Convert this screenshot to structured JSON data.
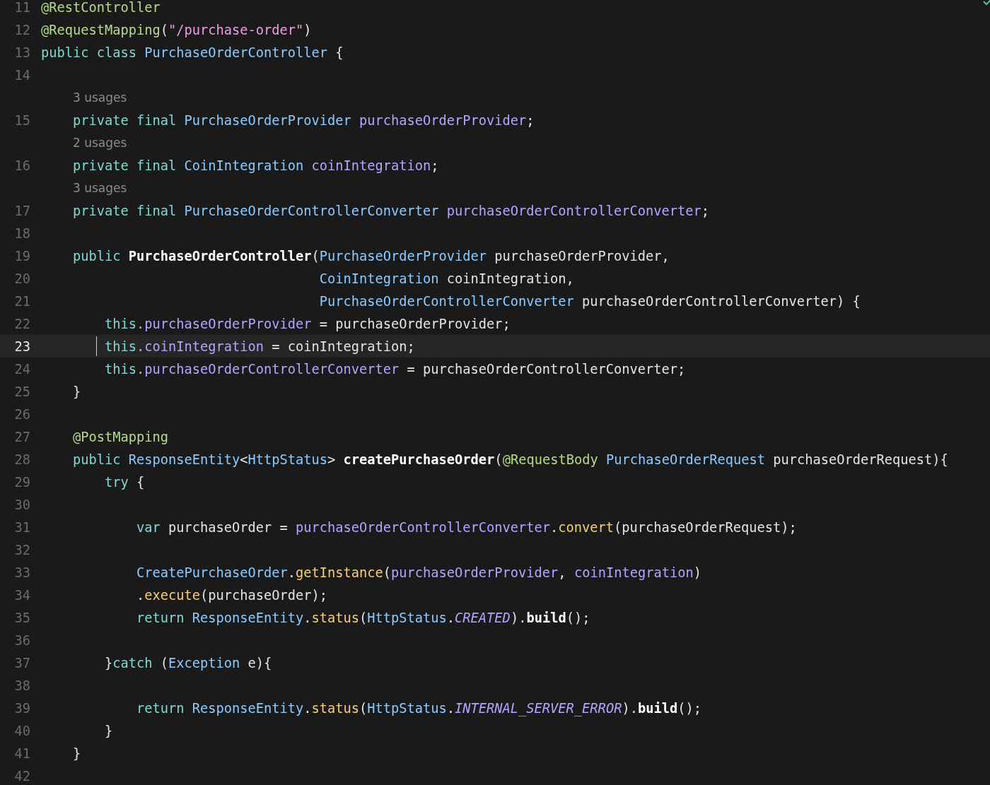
{
  "editor": {
    "lines": [
      {
        "number": "11",
        "kind": "code",
        "current": false,
        "tokens": [
          {
            "text": "@RestController",
            "kind": "annotation"
          }
        ]
      },
      {
        "number": "12",
        "kind": "code",
        "current": false,
        "tokens": [
          {
            "text": "@RequestMapping",
            "kind": "annotation"
          },
          {
            "text": "(",
            "kind": "plain"
          },
          {
            "text": "\"/purchase-order\"",
            "kind": "string"
          },
          {
            "text": ")",
            "kind": "plain"
          }
        ]
      },
      {
        "number": "13",
        "kind": "code",
        "current": false,
        "tokens": [
          {
            "text": "public class ",
            "kind": "keyword"
          },
          {
            "text": "PurchaseOrderController",
            "kind": "type"
          },
          {
            "text": " {",
            "kind": "plain"
          }
        ],
        "children": [
          {
            "number": "14",
            "kind": "code",
            "current": false
          },
          {
            "number": "15",
            "kind": "code",
            "current": false,
            "usages": "3 usages",
            "tokens": [
              {
                "text": "private final ",
                "kind": "keyword"
              },
              {
                "text": "PurchaseOrderProvider ",
                "kind": "type"
              },
              {
                "text": "purchaseOrderProvider",
                "kind": "field"
              },
              {
                "text": ";",
                "kind": "plain"
              }
            ]
          },
          {
            "number": "16",
            "kind": "code",
            "current": false,
            "usages": "2 usages",
            "tokens": [
              {
                "text": "private final ",
                "kind": "keyword"
              },
              {
                "text": "CoinIntegration ",
                "kind": "type"
              },
              {
                "text": "coinIntegration",
                "kind": "field"
              },
              {
                "text": ";",
                "kind": "plain"
              }
            ]
          },
          {
            "number": "17",
            "kind": "code",
            "current": false,
            "usages": "3 usages",
            "tokens": [
              {
                "text": "private final ",
                "kind": "keyword"
              },
              {
                "text": "PurchaseOrderControllerConverter ",
                "kind": "type"
              },
              {
                "text": "purchaseOrderControllerConverter",
                "kind": "field"
              },
              {
                "text": ";",
                "kind": "plain"
              }
            ]
          },
          {
            "number": "18",
            "kind": "code",
            "current": false
          },
          {
            "number": "19",
            "kind": "code",
            "current": false,
            "tokens": [
              {
                "text": "public ",
                "kind": "keyword"
              },
              {
                "text": "PurchaseOrderController",
                "kind": "decl"
              },
              {
                "text": "(",
                "kind": "plain"
              },
              {
                "text": "PurchaseOrderProvider",
                "kind": "type"
              },
              {
                "text": " purchaseOrderProvider,",
                "kind": "plain"
              }
            ],
            "children": [
              {
                "number": "20",
                "kind": "continuation",
                "current": false,
                "tokens": [
                  {
                    "text": "CoinIntegration",
                    "kind": "type"
                  },
                  {
                    "text": " coinIntegration,",
                    "kind": "plain"
                  }
                ]
              },
              {
                "number": "21",
                "kind": "continuation",
                "current": false,
                "tokens": [
                  {
                    "text": "PurchaseOrderControllerConverter",
                    "kind": "type"
                  },
                  {
                    "text": " purchaseOrderControllerConverter) {",
                    "kind": "plain"
                  }
                ]
              },
              {
                "number": "22",
                "kind": "code",
                "current": false,
                "tokens": [
                  {
                    "text": "this.",
                    "kind": "keyword"
                  },
                  {
                    "text": "purchaseOrderProvider",
                    "kind": "field"
                  },
                  {
                    "text": " = purchaseOrderProvider;",
                    "kind": "plain"
                  }
                ]
              },
              {
                "number": "23",
                "kind": "code",
                "current": true,
                "tokens": [
                  {
                    "text": "this.",
                    "kind": "keyword"
                  },
                  {
                    "text": "coinIntegration",
                    "kind": "field"
                  },
                  {
                    "text": " = coinIntegration;",
                    "kind": "plain"
                  }
                ]
              },
              {
                "number": "24",
                "kind": "code",
                "current": false,
                "tokens": [
                  {
                    "text": "this.",
                    "kind": "keyword"
                  },
                  {
                    "text": "purchaseOrderControllerConverter",
                    "kind": "field"
                  },
                  {
                    "text": " = purchaseOrderControllerConverter;",
                    "kind": "plain"
                  }
                ]
              }
            ]
          },
          {
            "number": "25",
            "kind": "code",
            "current": false,
            "tokens": [
              {
                "text": "}",
                "kind": "plain"
              }
            ]
          },
          {
            "number": "26",
            "kind": "code",
            "current": false
          },
          {
            "number": "27",
            "kind": "code",
            "current": false,
            "tokens": [
              {
                "text": "@PostMapping",
                "kind": "annotation"
              }
            ]
          },
          {
            "number": "28",
            "kind": "code",
            "current": false,
            "tokens": [
              {
                "text": "public ",
                "kind": "keyword"
              },
              {
                "text": "ResponseEntity",
                "kind": "type"
              },
              {
                "text": "<",
                "kind": "plain"
              },
              {
                "text": "HttpStatus",
                "kind": "type"
              },
              {
                "text": "> ",
                "kind": "plain"
              },
              {
                "text": "createPurchaseOrder",
                "kind": "decl"
              },
              {
                "text": "(",
                "kind": "plain"
              },
              {
                "text": "@RequestBody ",
                "kind": "annotation"
              },
              {
                "text": "PurchaseOrderRequest",
                "kind": "type"
              },
              {
                "text": " purchaseOrderRequest){",
                "kind": "plain"
              }
            ],
            "children": [
              {
                "number": "29",
                "kind": "code",
                "current": false,
                "tokens": [
                  {
                    "text": "try",
                    "kind": "keyword"
                  },
                  {
                    "text": " {",
                    "kind": "plain"
                  }
                ],
                "children": [
                  {
                    "number": "30",
                    "kind": "code",
                    "current": false
                  },
                  {
                    "number": "31",
                    "kind": "code",
                    "current": false,
                    "tokens": [
                      {
                        "text": "var",
                        "kind": "keyword"
                      },
                      {
                        "text": " purchaseOrder = ",
                        "kind": "plain"
                      },
                      {
                        "text": "purchaseOrderControllerConverter",
                        "kind": "field"
                      },
                      {
                        "text": ".",
                        "kind": "plain"
                      },
                      {
                        "text": "convert",
                        "kind": "method"
                      },
                      {
                        "text": "(purchaseOrderRequest);",
                        "kind": "plain"
                      }
                    ]
                  },
                  {
                    "number": "32",
                    "kind": "code",
                    "current": false
                  },
                  {
                    "number": "33",
                    "kind": "code",
                    "current": false,
                    "tokens": [
                      {
                        "text": "CreatePurchaseOrder",
                        "kind": "type"
                      },
                      {
                        "text": ".",
                        "kind": "plain"
                      },
                      {
                        "text": "getInstance",
                        "kind": "method"
                      },
                      {
                        "text": "(",
                        "kind": "plain"
                      },
                      {
                        "text": "purchaseOrderProvider",
                        "kind": "field"
                      },
                      {
                        "text": ", ",
                        "kind": "plain"
                      },
                      {
                        "text": "coinIntegration",
                        "kind": "field"
                      },
                      {
                        "text": ")",
                        "kind": "plain"
                      }
                    ]
                  },
                  {
                    "number": "34",
                    "kind": "code",
                    "current": false,
                    "tokens": [
                      {
                        "text": ".",
                        "kind": "plain"
                      },
                      {
                        "text": "execute",
                        "kind": "method"
                      },
                      {
                        "text": "(purchaseOrder);",
                        "kind": "plain"
                      }
                    ]
                  },
                  {
                    "number": "35",
                    "kind": "code",
                    "current": false,
                    "tokens": [
                      {
                        "text": "return ",
                        "kind": "keyword"
                      },
                      {
                        "text": "ResponseEntity",
                        "kind": "type"
                      },
                      {
                        "text": ".",
                        "kind": "plain"
                      },
                      {
                        "text": "status",
                        "kind": "method"
                      },
                      {
                        "text": "(",
                        "kind": "plain"
                      },
                      {
                        "text": "HttpStatus",
                        "kind": "type"
                      },
                      {
                        "text": ".",
                        "kind": "plain"
                      },
                      {
                        "text": "CREATED",
                        "kind": "constant"
                      },
                      {
                        "text": ").",
                        "kind": "plain"
                      },
                      {
                        "text": "build",
                        "kind": "decl"
                      },
                      {
                        "text": "();",
                        "kind": "plain"
                      }
                    ]
                  },
                  {
                    "number": "36",
                    "kind": "code",
                    "current": false
                  }
                ]
              },
              {
                "number": "37",
                "kind": "code",
                "current": false,
                "tokens": [
                  {
                    "text": "}",
                    "kind": "plain"
                  },
                  {
                    "text": "catch",
                    "kind": "keyword"
                  },
                  {
                    "text": " (",
                    "kind": "plain"
                  },
                  {
                    "text": "Exception",
                    "kind": "type"
                  },
                  {
                    "text": " e){",
                    "kind": "plain"
                  }
                ],
                "children": [
                  {
                    "number": "38",
                    "kind": "code",
                    "current": false
                  },
                  {
                    "number": "39",
                    "kind": "code",
                    "current": false,
                    "tokens": [
                      {
                        "text": "return ",
                        "kind": "keyword"
                      },
                      {
                        "text": "ResponseEntity",
                        "kind": "type"
                      },
                      {
                        "text": ".",
                        "kind": "plain"
                      },
                      {
                        "text": "status",
                        "kind": "method"
                      },
                      {
                        "text": "(",
                        "kind": "plain"
                      },
                      {
                        "text": "HttpStatus",
                        "kind": "type"
                      },
                      {
                        "text": ".",
                        "kind": "plain"
                      },
                      {
                        "text": "INTERNAL_SERVER_ERROR",
                        "kind": "constant"
                      },
                      {
                        "text": ").",
                        "kind": "plain"
                      },
                      {
                        "text": "build",
                        "kind": "decl"
                      },
                      {
                        "text": "();",
                        "kind": "plain"
                      }
                    ]
                  }
                ]
              },
              {
                "number": "40",
                "kind": "code",
                "current": false,
                "tokens": [
                  {
                    "text": "}",
                    "kind": "plain"
                  }
                ]
              }
            ]
          },
          {
            "number": "41",
            "kind": "code",
            "current": false,
            "tokens": [
              {
                "text": "}",
                "kind": "plain"
              }
            ]
          }
        ]
      },
      {
        "number": "42",
        "kind": "code",
        "current": false
      }
    ]
  }
}
